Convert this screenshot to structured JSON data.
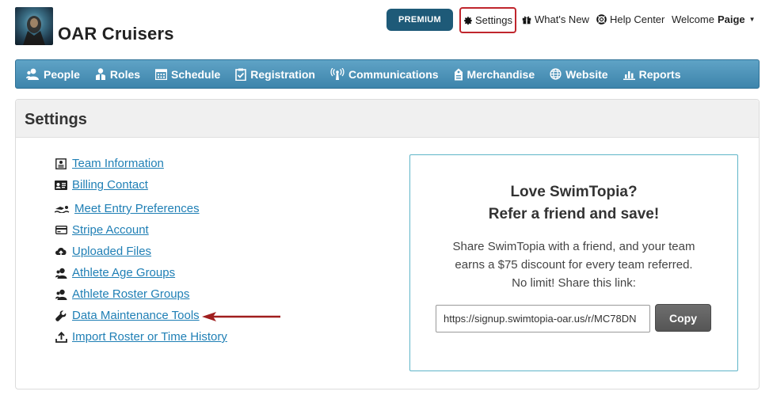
{
  "header": {
    "team_name": "OAR Cruisers",
    "premium_label": "PREMIUM",
    "settings_label": "Settings",
    "whats_new_label": "What's New",
    "help_center_label": "Help Center",
    "welcome_prefix": "Welcome",
    "user_name": "Paige"
  },
  "nav": {
    "items": [
      {
        "label": "People",
        "icon": "people-icon"
      },
      {
        "label": "Roles",
        "icon": "roles-icon"
      },
      {
        "label": "Schedule",
        "icon": "calendar-icon"
      },
      {
        "label": "Registration",
        "icon": "clipboard-check-icon"
      },
      {
        "label": "Communications",
        "icon": "broadcast-icon"
      },
      {
        "label": "Merchandise",
        "icon": "tag-icon"
      },
      {
        "label": "Website",
        "icon": "globe-icon"
      },
      {
        "label": "Reports",
        "icon": "bar-chart-icon"
      }
    ]
  },
  "page": {
    "title": "Settings"
  },
  "settings_links": [
    {
      "label": "Team Information",
      "icon": "id-card-icon"
    },
    {
      "label": "Billing Contact",
      "icon": "contact-card-icon"
    },
    {
      "label": "Meet Entry Preferences",
      "icon": "swimmer-icon"
    },
    {
      "label": "Stripe Account",
      "icon": "credit-card-icon"
    },
    {
      "label": "Uploaded Files",
      "icon": "cloud-upload-icon"
    },
    {
      "label": "Athlete Age Groups",
      "icon": "users-icon"
    },
    {
      "label": "Athlete Roster Groups",
      "icon": "users-icon"
    },
    {
      "label": "Data Maintenance Tools",
      "icon": "wrench-icon"
    },
    {
      "label": "Import Roster or Time History",
      "icon": "upload-icon"
    }
  ],
  "refer": {
    "title_line1": "Love SwimTopia?",
    "title_line2": "Refer a friend and save!",
    "text_line1": "Share SwimTopia with a friend, and your team",
    "text_line2": "earns a $75 discount for every team referred.",
    "text_line3": "No limit! Share this link:",
    "link_value": "https://signup.swimtopia-oar.us/r/MC78DN",
    "copy_label": "Copy"
  },
  "colors": {
    "nav_bar": "#4a91b8",
    "premium": "#1e5a78",
    "link": "#1f7fb5",
    "highlight": "#c0262d",
    "arrow": "#a01e1e"
  }
}
